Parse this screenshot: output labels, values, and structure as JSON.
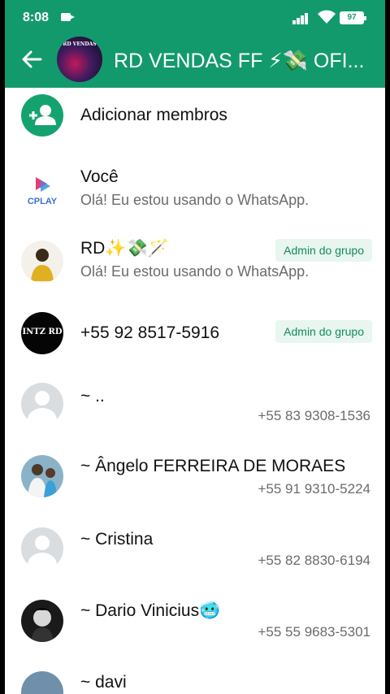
{
  "status_bar": {
    "time": "8:08",
    "battery": "97"
  },
  "header": {
    "title": "RD VENDAS FF ⚡💸 OFI...",
    "avatar_text": "RD VENDAS"
  },
  "add_members": {
    "label": "Adicionar membros"
  },
  "you": {
    "avatar_text": "CPLAY"
  },
  "members": [
    {
      "name": "Você",
      "status": "Olá! Eu estou usando o WhatsApp."
    },
    {
      "name": "RD✨💸🪄",
      "status": "Olá! Eu estou usando o WhatsApp.",
      "badge": "Admin do grupo"
    },
    {
      "name": "+55 92 8517-5916",
      "badge": "Admin do grupo",
      "avatar_text": "INTZ RD"
    },
    {
      "name": "~ ..",
      "phone": "+55 83 9308-1536"
    },
    {
      "name": "~ Ângelo FERREIRA DE MORAES",
      "phone": "+55 91 9310-5224"
    },
    {
      "name": "~ Cristina",
      "phone": "+55 82 8830-6194"
    },
    {
      "name": "~ Dario Vinicius🥶",
      "phone": "+55 55 9683-5301"
    },
    {
      "name": "~ davi"
    }
  ],
  "colors": {
    "primary": "#139a6c",
    "admin_badge_bg": "#e8f6ef",
    "admin_badge_text": "#138a5e"
  }
}
